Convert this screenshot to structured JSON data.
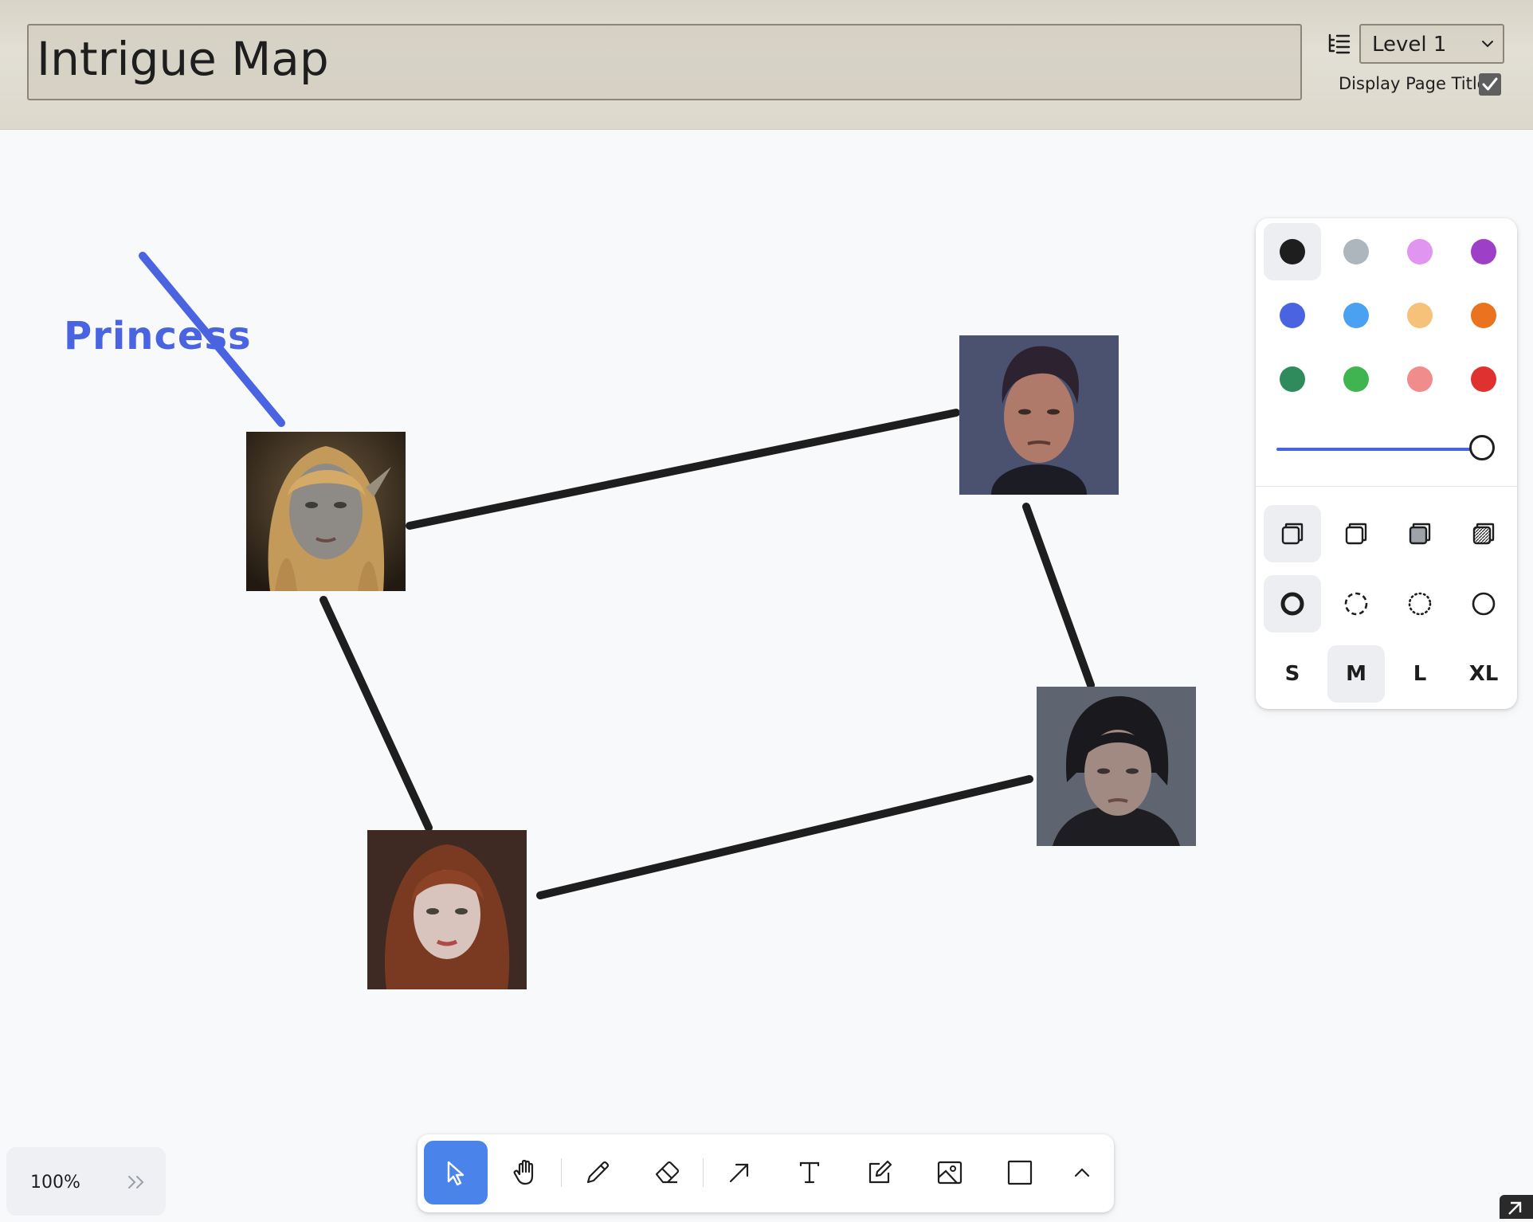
{
  "header": {
    "title": "Intrigue Map",
    "level_select": "Level 1",
    "display_page_title_label": "Display Page Title",
    "display_page_title_checked": true
  },
  "canvas": {
    "text_labels": [
      "Princess"
    ],
    "portraits": [
      {
        "name": "elf-woman-portrait",
        "subject": "blonde elf woman"
      },
      {
        "name": "dark-haired-man-portrait",
        "subject": "dark-haired man"
      },
      {
        "name": "raven-haired-man-portrait",
        "subject": "raven-haired man"
      },
      {
        "name": "red-haired-woman-portrait",
        "subject": "red-haired woman"
      }
    ],
    "connectors": [
      {
        "from": "Princess",
        "to": "elf-woman-portrait",
        "color": "#4a63e0"
      },
      {
        "from": "elf-woman-portrait",
        "to": "dark-haired-man-portrait",
        "color": "#1e1e1e"
      },
      {
        "from": "dark-haired-man-portrait",
        "to": "raven-haired-man-portrait",
        "color": "#1e1e1e"
      },
      {
        "from": "raven-haired-man-portrait",
        "to": "red-haired-woman-portrait",
        "color": "#1e1e1e"
      },
      {
        "from": "elf-woman-portrait",
        "to": "red-haired-woman-portrait",
        "color": "#1e1e1e"
      }
    ]
  },
  "style_panel": {
    "colors": [
      "#1e1e1e",
      "#adb5bd",
      "#e095f0",
      "#9e3fc8",
      "#4a63e0",
      "#4ba1f1",
      "#f6c27a",
      "#e9731e",
      "#2f8a5c",
      "#3fb450",
      "#f08c8c",
      "#e03131"
    ],
    "selected_color": "#1e1e1e",
    "opacity_percent": 100,
    "fill_options": [
      "fill-none-icon",
      "fill-semi-icon",
      "fill-solid-icon",
      "fill-pattern-icon"
    ],
    "selected_fill": "fill-none-icon",
    "dash_options": [
      "dash-draw-icon",
      "dash-dashed-icon",
      "dash-dotted-icon",
      "dash-solid-icon"
    ],
    "selected_dash": "dash-draw-icon",
    "sizes": [
      "S",
      "M",
      "L",
      "XL"
    ],
    "selected_size": "M"
  },
  "zoom": {
    "level": "100%"
  },
  "toolbar": {
    "tools": [
      "select-tool",
      "hand-tool",
      "draw-tool",
      "eraser-tool",
      "arrow-tool",
      "text-tool",
      "note-tool",
      "image-tool",
      "rectangle-tool",
      "more-tools"
    ],
    "active_tool": "select-tool"
  }
}
